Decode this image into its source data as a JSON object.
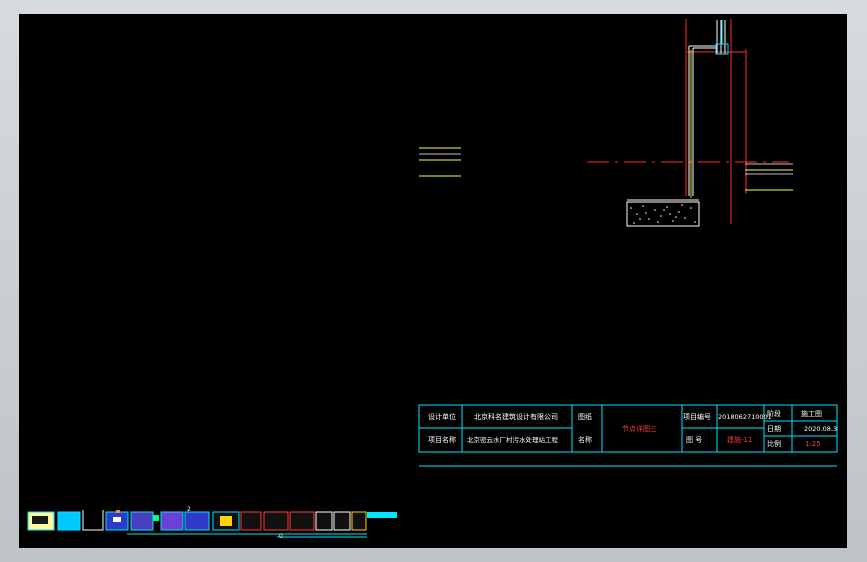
{
  "colors": {
    "background": "#000000",
    "frame": "#c7cbd0",
    "title_block_lines": "#00e5ff",
    "yellow_lines": "#ffff33",
    "red_lines": "#ff2a2a",
    "white_lines": "#ffffff"
  },
  "title_block": {
    "design_unit_label": "设计单位",
    "design_unit_value": "北京科名建筑设计有限公司",
    "project_name_label": "项目名称",
    "project_name_value": "北京密云水厂村污水处理站工程",
    "drawing_label_top": "图纸",
    "drawing_label_bottom": "名称",
    "drawing_name": "节点详图三",
    "project_no_label": "项目编号",
    "project_no_value": "2018062710001",
    "drawing_no_label": "图 号",
    "drawing_no_value": "建施-11",
    "stage_label": "阶段",
    "stage_value": "施工图",
    "date_label": "日期",
    "date_value": "2020.08.3",
    "scale_label": "比例",
    "scale_value": "1:25"
  },
  "thumbnails": {
    "tab_number": "2",
    "bottom_label": "0",
    "items": [
      {
        "name": "thumb-1",
        "color": "#ffff00"
      },
      {
        "name": "thumb-2",
        "color": "#00c8ff"
      },
      {
        "name": "thumb-3",
        "color": "#ffffff"
      },
      {
        "name": "thumb-4",
        "color": "#00e5ff"
      },
      {
        "name": "thumb-5",
        "color": "#b04aff"
      },
      {
        "name": "thumb-6",
        "color": "#ff3b3b"
      },
      {
        "name": "thumb-7",
        "color": "#00e5ff"
      }
    ]
  }
}
